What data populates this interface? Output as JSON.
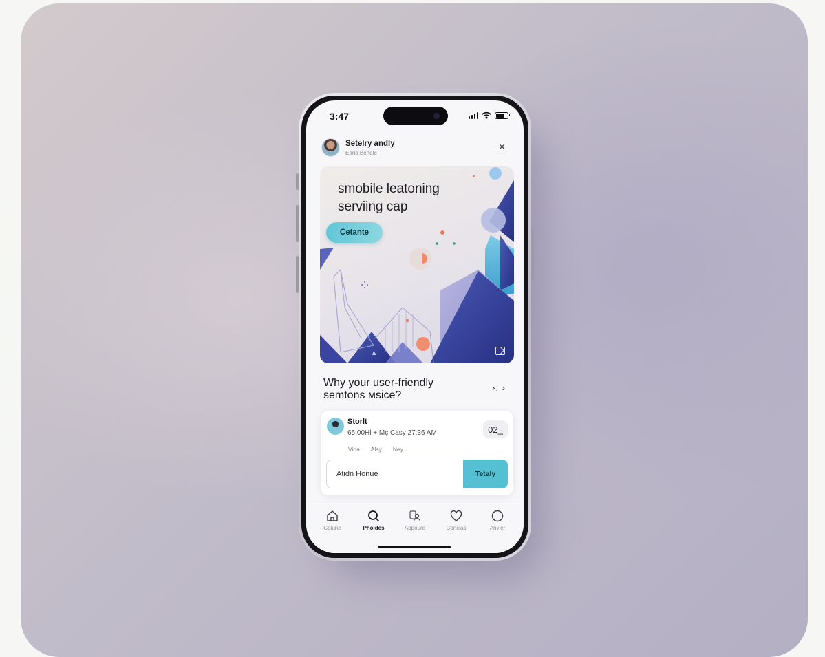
{
  "status_bar": {
    "time": "3:47"
  },
  "profile": {
    "name": "Setelry andly",
    "subtitle": "Eario Bendle"
  },
  "hero": {
    "title_line1": "smobile leatoning",
    "title_line2": "serviing cap",
    "cta_label": "Cetante"
  },
  "section": {
    "title_line1": "Why your user-friendly",
    "title_line2": "semtons мsice?",
    "arrow": "›. ›"
  },
  "card": {
    "name": "Storlt",
    "meta": "65.00Ħl + Mç Casy 27:36 AM",
    "tags": [
      "Vioa",
      "Alsy",
      "Ney"
    ],
    "badge": "02_",
    "input_placeholder": "Atidn Honue",
    "submit_label": "Tetaly"
  },
  "tabbar": {
    "tabs": [
      {
        "label": "Coiune",
        "icon": "home-icon"
      },
      {
        "label": "Pholdes",
        "icon": "search-icon",
        "active": true
      },
      {
        "label": "Appoure",
        "icon": "people-icon"
      },
      {
        "label": "Conclas",
        "icon": "heart-icon"
      },
      {
        "label": "Anvier",
        "icon": "circle-icon"
      }
    ]
  },
  "colors": {
    "accent": "#56c0d3",
    "hero_blue": "#2c3a8c",
    "hero_coral": "#ee8a6a"
  }
}
